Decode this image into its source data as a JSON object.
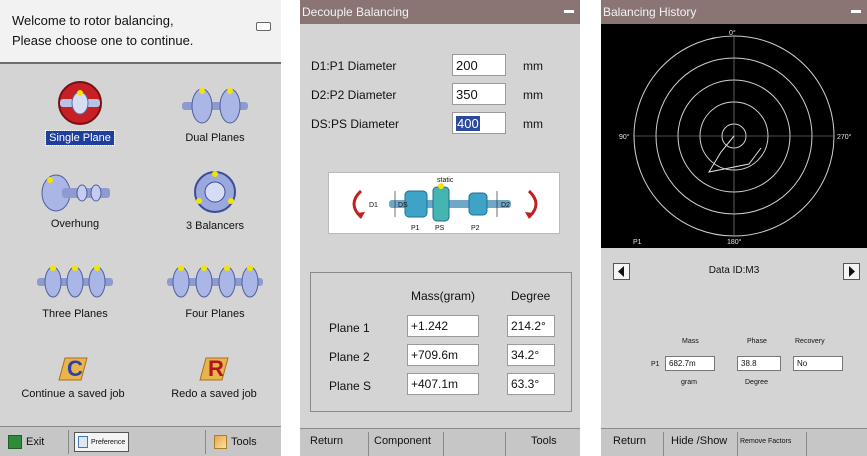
{
  "screen1": {
    "welcome_line1": "Welcome to rotor balancing,",
    "welcome_line2": "Please choose one to continue.",
    "modes": [
      {
        "label": "Single Plane",
        "icon": "single-plane-rotor-icon",
        "selected": true
      },
      {
        "label": "Dual Planes",
        "icon": "dual-planes-rotor-icon",
        "selected": false
      },
      {
        "label": "Overhung",
        "icon": "overhung-rotor-icon",
        "selected": false
      },
      {
        "label": "3 Balancers",
        "icon": "three-balancers-icon",
        "selected": false
      },
      {
        "label": "Three Planes",
        "icon": "three-planes-rotor-icon",
        "selected": false
      },
      {
        "label": "Four Planes",
        "icon": "four-planes-rotor-icon",
        "selected": false
      },
      {
        "label": "Continue a saved job",
        "icon": "continue-job-icon",
        "letter": "C",
        "selected": false
      },
      {
        "label": "Redo a saved job",
        "icon": "redo-job-icon",
        "letter": "R",
        "selected": false
      }
    ],
    "toolbar": {
      "exit": "Exit",
      "preference": "Preference",
      "tools": "Tools"
    }
  },
  "screen2": {
    "title": "Decouple Balancing",
    "fields": [
      {
        "label": "D1:P1 Diameter",
        "value": "200",
        "unit": "mm"
      },
      {
        "label": "D2:P2 Diameter",
        "value": "350",
        "unit": "mm"
      },
      {
        "label": "DS:PS Diameter",
        "value": "400",
        "unit": "mm",
        "highlighted": true
      }
    ],
    "diagram": {
      "static": "static",
      "d1": "D1",
      "ds": "DS",
      "d2": "D2",
      "p1": "P1",
      "ps": "PS",
      "p2": "P2"
    },
    "results": {
      "header_mass": "Mass(gram)",
      "header_degree": "Degree",
      "rows": [
        {
          "plane": "Plane 1",
          "mass": "+1.242",
          "degree": "214.2°"
        },
        {
          "plane": "Plane 2",
          "mass": "+709.6m",
          "degree": "34.2°"
        },
        {
          "plane": "Plane S",
          "mass": "+407.1m",
          "degree": "63.3°"
        }
      ]
    },
    "toolbar": {
      "return": "Return",
      "component": "Component",
      "tools": "Tools"
    }
  },
  "screen3": {
    "title": "Balancing History",
    "polar": {
      "top": "0°",
      "left": "90°",
      "right": "270°",
      "bottom": "180°",
      "corner": "P1"
    },
    "data_id": "Data ID:M3",
    "table": {
      "headers": {
        "mass": "Mass",
        "phase": "Phase",
        "recovery": "Recovery"
      },
      "row_label": "P1",
      "mass": "682.7m",
      "phase": "38.8",
      "recovery": "No",
      "units": {
        "mass": "gram",
        "phase": "Degree"
      }
    },
    "toolbar": {
      "return": "Return",
      "hide_show": "Hide /Show",
      "remove_factors": "Remove Factors"
    }
  },
  "colors": {
    "title_bar": "#8a7474",
    "selected": "#1e3f9c",
    "panel": "#d4d4d4",
    "polar_bg": "#000000"
  }
}
